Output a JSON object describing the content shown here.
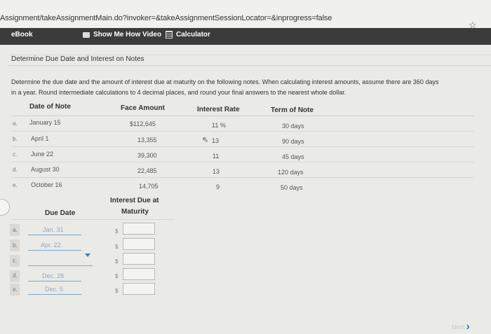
{
  "browser": {
    "url": "Assignment/takeAssignmentMain.do?invoker=&takeAssignmentSessionLocator=&inprogress=false"
  },
  "toolbar": {
    "ebook": "eBook",
    "show_me_video": "Show Me How Video",
    "calculator": "Calculator"
  },
  "section": {
    "title": "Determine Due Date and Interest on Notes"
  },
  "instructions": {
    "line1": "Determine the due date and the amount of interest due at maturity on the following notes. When calculating interest amounts, assume there are 360 days",
    "line2": "in a year. Round intermediate calculations to 4 decimal places, and round your final answers to the nearest whole dollar."
  },
  "notes_table": {
    "headers": [
      "Date of Note",
      "Face Amount",
      "Interest Rate",
      "Term of Note"
    ],
    "rows": [
      {
        "letter": "a.",
        "date": "January 15",
        "face": "$112,645",
        "rate": "11 %",
        "term": "30 days"
      },
      {
        "letter": "b.",
        "date": "April 1",
        "face": "13,355",
        "rate": "13",
        "term": "90 days"
      },
      {
        "letter": "c.",
        "date": "June 22",
        "face": "39,300",
        "rate": "11",
        "term": "45 days"
      },
      {
        "letter": "d.",
        "date": "August 30",
        "face": "22,485",
        "rate": "13",
        "term": "120 days"
      },
      {
        "letter": "e.",
        "date": "October 16",
        "face": "14,705",
        "rate": "9",
        "term": "50 days"
      }
    ]
  },
  "answer_table": {
    "header_due_date": "Due Date",
    "header_interest_line1": "Interest Due at",
    "header_interest_line2": "Maturity",
    "currency": "$",
    "rows": [
      {
        "letter": "a.",
        "due_date": "Jan. 31",
        "interest": ""
      },
      {
        "letter": "b.",
        "due_date": "Apr. 22",
        "interest": ""
      },
      {
        "letter": "c.",
        "due_date": "",
        "interest": ""
      },
      {
        "letter": "d.",
        "due_date": "Dec. 28",
        "interest": ""
      },
      {
        "letter": "e.",
        "due_date": "Dec. 5",
        "interest": ""
      }
    ]
  },
  "footer": {
    "next": "Next"
  }
}
